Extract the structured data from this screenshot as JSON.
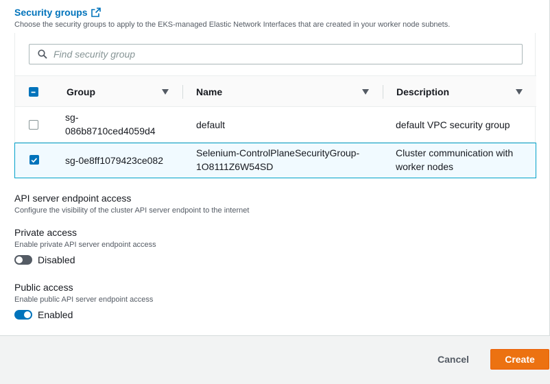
{
  "security_groups": {
    "title": "Security groups",
    "description": "Choose the security groups to apply to the EKS-managed Elastic Network Interfaces that are created in your worker node subnets.",
    "search_placeholder": "Find security group",
    "columns": [
      "Group",
      "Name",
      "Description"
    ],
    "rows": [
      {
        "group": "sg-086b8710ced4059d4",
        "group_wrapped": [
          "sg-",
          "086b8710ced4059d4"
        ],
        "name": "default",
        "description": "default VPC security group",
        "selected": false
      },
      {
        "group": "sg-0e8ff1079423ce082",
        "name_wrapped": [
          "Selenium-ControlPlaneSecurityGroup-",
          "1O8111Z6W54SD"
        ],
        "description_wrapped": [
          "Cluster communication with",
          "worker nodes"
        ],
        "selected": true
      }
    ]
  },
  "endpoint": {
    "title": "API server endpoint access",
    "description": "Configure the visibility of the cluster API server endpoint to the internet",
    "private": {
      "label": "Private access",
      "hint": "Enable private API server endpoint access",
      "state": "Disabled",
      "enabled": false
    },
    "public": {
      "label": "Public access",
      "hint": "Enable public API server endpoint access",
      "state": "Enabled",
      "enabled": true
    }
  },
  "footer": {
    "cancel": "Cancel",
    "create": "Create"
  },
  "colors": {
    "link": "#0073bb",
    "primary": "#ec7211",
    "selected_row_bg": "#f1faff",
    "selected_row_border": "#00a1c9"
  },
  "icons": {
    "title": "external-link-icon",
    "search": "search-icon",
    "sort": "caret-down-icon"
  }
}
